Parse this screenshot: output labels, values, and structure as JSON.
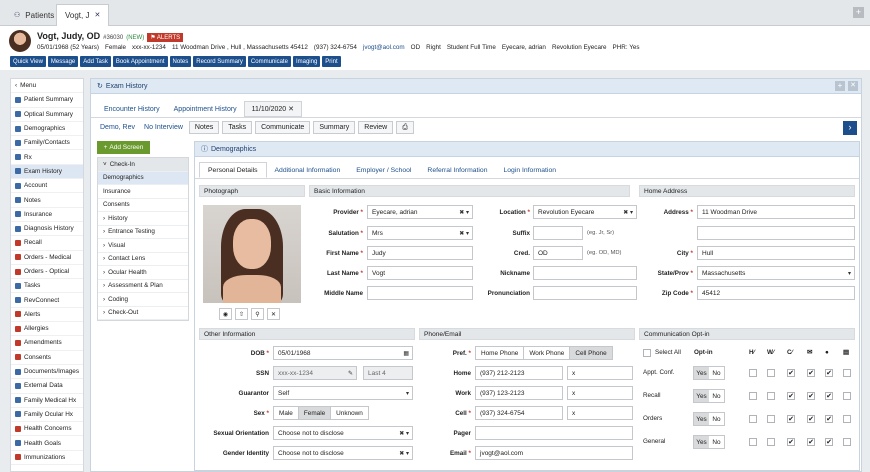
{
  "tabs": {
    "patients": "Patients",
    "patient_tab": "Vogt, J"
  },
  "patient": {
    "name": "Vogt, Judy, OD",
    "id": "#36030",
    "new_badge": "(NEW)",
    "alerts": "ALERTS",
    "dob_age": "05/01/1968 (52 Years)",
    "sex": "Female",
    "ssn": "xxx-xx-1234",
    "address": "11 Woodman Drive , Hull , Massachusetts 45412",
    "phone": "(937) 324-6754",
    "email": "jvogt@aol.com",
    "eye": "OD",
    "hand": "Right",
    "student": "Student Full Time",
    "provider": "Eyecare, adrian",
    "location": "Revolution Eyecare",
    "phr": "PHR: Yes"
  },
  "toolbar": [
    "Quick View",
    "Message",
    "Add Task",
    "Book Appointment",
    "Notes",
    "Record Summary",
    "Communicate",
    "Imaging",
    "Print"
  ],
  "leftnav": {
    "menu": "Menu",
    "items": [
      "Patient Summary",
      "Optical Summary",
      "Demographics",
      "Family/Contacts",
      "Rx",
      "Exam History",
      "Account",
      "Notes",
      "Insurance",
      "Diagnosis History",
      "Recall",
      "Orders - Medical",
      "Orders - Optical",
      "Tasks",
      "RevConnect",
      "Alerts",
      "Allergies",
      "Amendments",
      "Consents",
      "Documents/Images",
      "External Data",
      "Family Medical Hx",
      "Family Ocular Hx",
      "Health Concerns",
      "Health Goals",
      "Immunizations"
    ]
  },
  "exam": {
    "title": "Exam History",
    "subtabs": [
      "Encounter History",
      "Appointment History",
      "11/10/2020"
    ],
    "links": [
      "Demo, Rev",
      "No Interview"
    ],
    "buttons": [
      "Notes",
      "Tasks",
      "Communicate",
      "Summary",
      "Review"
    ],
    "add_screen": "Add Screen",
    "checkin": "Check-In",
    "checkin_items": [
      "Demographics",
      "Insurance",
      "Consents"
    ],
    "sections": [
      "History",
      "Entrance Testing",
      "Visual",
      "Contact Lens",
      "Ocular Health",
      "Assessment & Plan",
      "Coding",
      "Check-Out"
    ]
  },
  "demographics": {
    "title": "Demographics",
    "tabs": [
      "Personal Details",
      "Additional Information",
      "Employer / School",
      "Referral Information",
      "Login Information"
    ],
    "photo_head": "Photograph",
    "basic_head": "Basic Information",
    "home_head": "Home Address",
    "other_head": "Other Information",
    "phone_head": "Phone/Email",
    "comm_head": "Communication Opt-in",
    "basic": {
      "provider_label": "Provider",
      "provider": "Eyecare, adrian",
      "salutation_label": "Salutation",
      "salutation": "Mrs",
      "first_label": "First Name",
      "first": "Judy",
      "last_label": "Last Name",
      "last": "Vogt",
      "middle_label": "Middle Name",
      "location_label": "Location",
      "location": "Revolution Eyecare",
      "suffix_label": "Suffix",
      "suffix_hint": "(eg. Jr, Sr)",
      "cred_label": "Cred.",
      "cred": "OD",
      "cred_hint": "(eg. OD, MD)",
      "nickname_label": "Nickname",
      "pron_label": "Pronunciation"
    },
    "home": {
      "address_label": "Address",
      "address": "11 Woodman Drive",
      "city_label": "City",
      "city": "Hull",
      "state_label": "State/Prov",
      "state": "Massachusetts",
      "zip_label": "Zip Code",
      "zip": "45412"
    },
    "other": {
      "dob_label": "DOB",
      "dob": "05/01/1968",
      "ssn_label": "SSN",
      "ssn": "xxx-xx-1234",
      "last4": "Last 4",
      "guarantor_label": "Guarantor",
      "guarantor": "Self",
      "sex_label": "Sex",
      "sex_options": [
        "Male",
        "Female",
        "Unknown"
      ],
      "orient_label": "Sexual Orientation",
      "orient": "Choose not to disclose",
      "gender_label": "Gender Identity",
      "gender": "Choose not to disclose"
    },
    "phone": {
      "pref_label": "Pref.",
      "pref_options": [
        "Home Phone",
        "Work Phone",
        "Cell Phone"
      ],
      "home_label": "Home",
      "home": "(937) 212-2123",
      "work_label": "Work",
      "work": "(937) 123-2123",
      "cell_label": "Cell",
      "cell": "(937) 324-6754",
      "pager_label": "Pager",
      "email_label": "Email",
      "email": "jvogt@aol.com",
      "x": "x"
    },
    "comm": {
      "select_all": "Select All",
      "optin": "Opt-in",
      "rows": [
        "Appt. Conf.",
        "Recall",
        "Orders",
        "General"
      ],
      "yes": "Yes",
      "no": "No"
    }
  },
  "colors": {
    "accent": "#1d4f8c",
    "alert": "#c0392b",
    "add": "#6a9a2e"
  }
}
